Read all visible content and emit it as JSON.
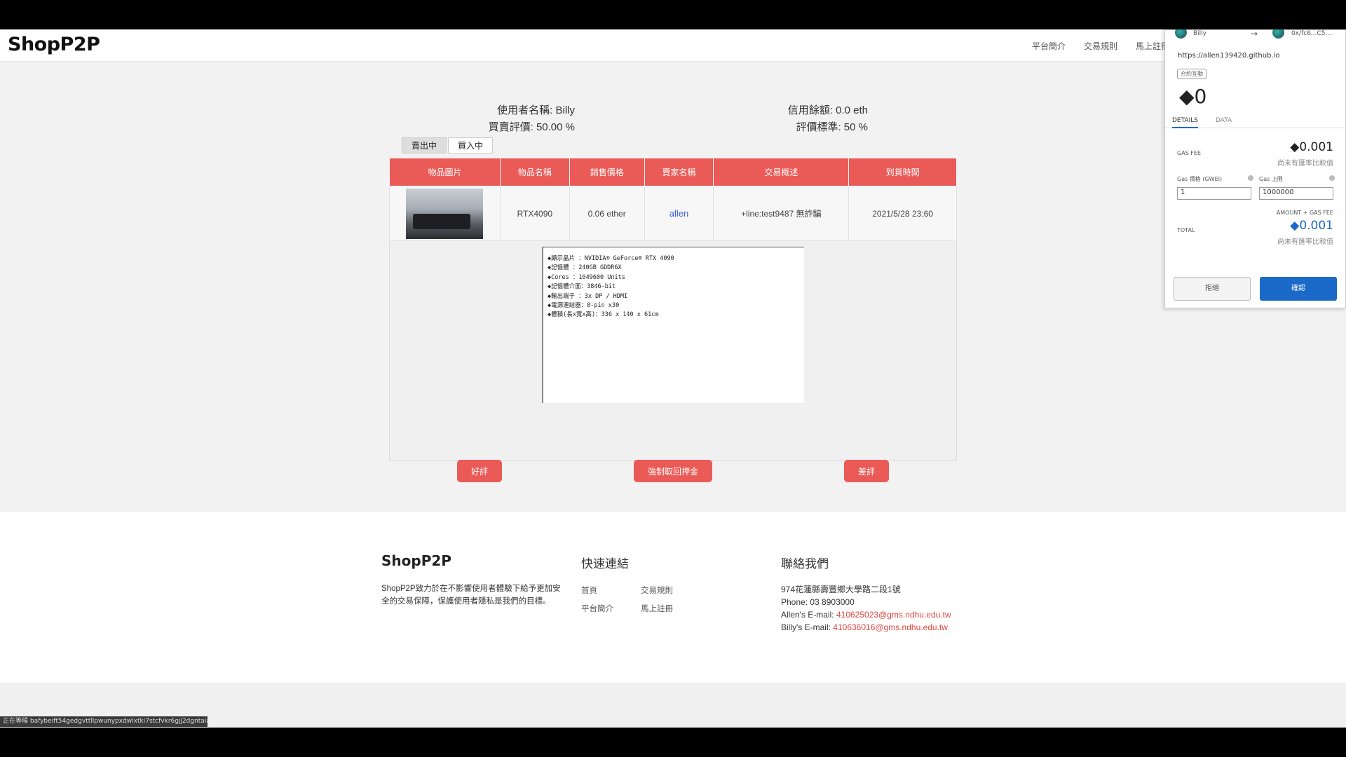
{
  "header": {
    "logo": "ShopP2P",
    "nav": [
      "平台簡介",
      "交易規則",
      "馬上註冊"
    ]
  },
  "user_info": {
    "username": "使用者名稱: Billy",
    "rating": "買賣評價: 50.00 %",
    "balance": "信用餘額: 0.0 eth",
    "standard": "評價標準: 50 %"
  },
  "tabs": [
    "賣出中",
    "買入中"
  ],
  "table": {
    "headers": [
      "物品圖片",
      "物品名稱",
      "銷售價格",
      "賣家名稱",
      "交易概述",
      "到貨時間"
    ],
    "row": {
      "name": "RTX4090",
      "price": "0.06 ether",
      "seller": "allen",
      "summary": "+line:test9487 無詐騙",
      "arrival": "2021/5/28 23:60"
    }
  },
  "specs": [
    "顯示晶片 ：NVIDIA® GeForce® RTX 4090",
    "記憶體 ：240GB GDDR6X",
    "Cores ：1049600 Units",
    "記憶體介面：3846-bit",
    "輸出端子 ：3x DP / HDMI",
    "電源連結器：8-pin x30",
    "體積(長x寬x高)：336 x 140 x 61cm"
  ],
  "actions": {
    "good": "好評",
    "refund": "強制取回押金",
    "bad": "差評"
  },
  "footer": {
    "logo": "ShopP2P",
    "about": "ShopP2P致力於在不影響使用者體驗下給予更加安全的交易保障，保護使用者隱私是我們的目標。",
    "links_title": "快速連結",
    "links": [
      "首頁",
      "交易規則",
      "平台簡介",
      "馬上註冊"
    ],
    "contact_title": "聯絡我們",
    "address": "974花蓮縣壽豐鄉大學路二段1號",
    "phone": "Phone: 03 8903000",
    "allen_label": "Allen's E-mail: ",
    "allen_mail": "410625023@gms.ndhu.edu.tw",
    "billy_label": "Billy's E-mail: ",
    "billy_mail": "410636016@gms.ndhu.edu.tw"
  },
  "status_bar": "正在等候 bafybeift54gedgvttllpwunypxdwlxtki7stcfvkr6gjj2dgntaia...",
  "wallet": {
    "account": "Billy",
    "arrow": "→",
    "to_address": "0x/fc6...C5...",
    "url": "https://allen139420.github.io",
    "badge": "合約互動",
    "amount": "◆0",
    "tabs": [
      "DETAILS",
      "DATA"
    ],
    "gas_fee_label": "GAS FEE",
    "gas_fee_value": "◆0.001",
    "gas_fee_note": "尚未有匯率比較值",
    "gas_price_label": "Gas 價格 (GWEI)",
    "gas_price_value": "1",
    "gas_limit_label": "Gas 上限",
    "gas_limit_value": "1000000",
    "amount_gas_label": "AMOUNT + GAS FEE",
    "total_label": "TOTAL",
    "total_value": "◆0.001",
    "total_note": "尚未有匯率比較值",
    "reject": "拒絕",
    "confirm": "確認"
  },
  "colors": {
    "accent_red": "#ea5a57",
    "link_blue": "#3b5bdb",
    "wallet_blue": "#1b6ac9"
  }
}
